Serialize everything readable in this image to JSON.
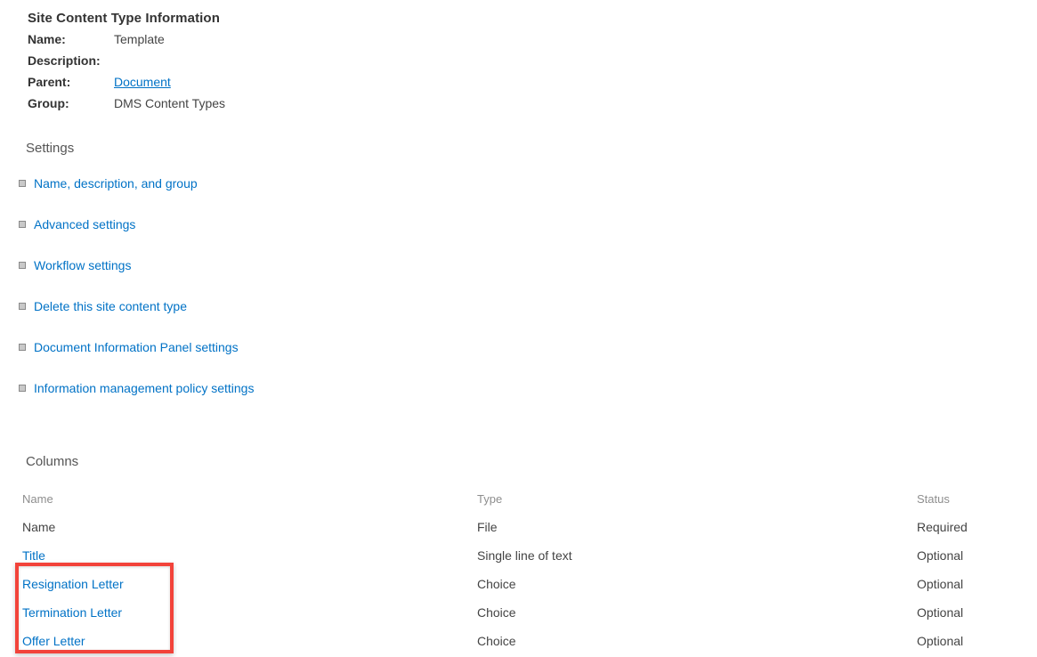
{
  "info": {
    "title": "Site Content Type Information",
    "rows": [
      {
        "label": "Name:",
        "value": "Template",
        "is_link": false
      },
      {
        "label": "Description:",
        "value": "",
        "is_link": false
      },
      {
        "label": "Parent:",
        "value": "Document",
        "is_link": true
      },
      {
        "label": "Group:",
        "value": "DMS Content Types",
        "is_link": false
      }
    ]
  },
  "settings": {
    "heading": "Settings",
    "bullet_icon": "square-bullet-icon",
    "items": [
      {
        "label": "Name, description, and group"
      },
      {
        "label": "Advanced settings"
      },
      {
        "label": "Workflow settings"
      },
      {
        "label": "Delete this site content type"
      },
      {
        "label": "Document Information Panel settings"
      },
      {
        "label": "Information management policy settings"
      }
    ]
  },
  "columns": {
    "heading": "Columns",
    "headers": [
      "Name",
      "Type",
      "Status"
    ],
    "rows": [
      {
        "name": "Name",
        "is_link": false,
        "type": "File",
        "status": "Required"
      },
      {
        "name": "Title",
        "is_link": true,
        "type": "Single line of text",
        "status": "Optional"
      },
      {
        "name": "Resignation Letter",
        "is_link": true,
        "type": "Choice",
        "status": "Optional"
      },
      {
        "name": "Termination Letter",
        "is_link": true,
        "type": "Choice",
        "status": "Optional"
      },
      {
        "name": "Offer Letter",
        "is_link": true,
        "type": "Choice",
        "status": "Optional"
      }
    ]
  },
  "annotation": {
    "color": "#f2433a"
  },
  "theme": {
    "link_color": "#0072c6",
    "text_color": "#444444",
    "heading_color": "#555555",
    "muted_color": "#8e8e8e",
    "background": "#ffffff"
  }
}
